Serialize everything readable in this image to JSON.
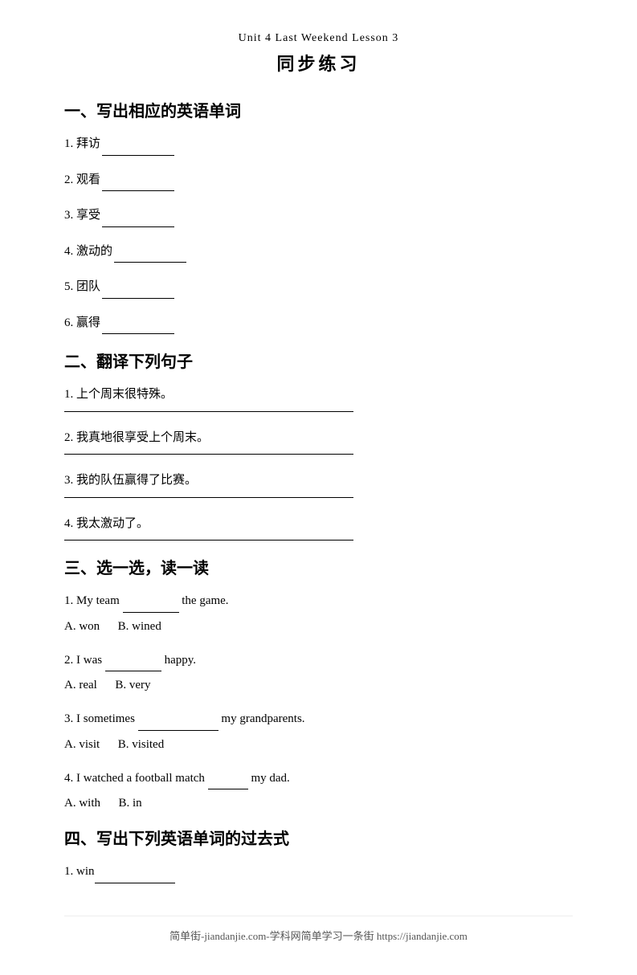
{
  "header": {
    "subtitle": "Unit 4 Last Weekend Lesson 3",
    "title": "同步练习"
  },
  "section1": {
    "title": "一、写出相应的英语单词",
    "items": [
      {
        "num": "1.",
        "text": "拜访"
      },
      {
        "num": "2.",
        "text": "观看"
      },
      {
        "num": "3.",
        "text": "享受"
      },
      {
        "num": "4.",
        "text": "激动的"
      },
      {
        "num": "5.",
        "text": "团队"
      },
      {
        "num": "6.",
        "text": "赢得"
      }
    ]
  },
  "section2": {
    "title": "二、翻译下列句子",
    "items": [
      {
        "num": "1.",
        "text": "上个周末很特殊。"
      },
      {
        "num": "2.",
        "text": "我真地很享受上个周末。"
      },
      {
        "num": "3.",
        "text": "我的队伍赢得了比赛。"
      },
      {
        "num": "4.",
        "text": "我太激动了。"
      }
    ]
  },
  "section3": {
    "title": "三、选一选，读一读",
    "questions": [
      {
        "num": "1.",
        "before": "My team",
        "after": "the game.",
        "optionA": "A. won",
        "optionB": "B. wined"
      },
      {
        "num": "2.",
        "before": "I was",
        "after": "happy.",
        "optionA": "A. real",
        "optionB": "B. very"
      },
      {
        "num": "3.",
        "before": "I sometimes",
        "after": "my grandparents.",
        "optionA": "A. visit",
        "optionB": "B. visited"
      },
      {
        "num": "4.",
        "before": "I watched a football match",
        "after": "my dad.",
        "optionA": "A. with",
        "optionB": "B. in"
      }
    ]
  },
  "section4": {
    "title": "四、写出下列英语单词的过去式",
    "items": [
      {
        "num": "1.",
        "text": "win"
      }
    ]
  },
  "footer": {
    "text": "简单街-jiandanjie.com-学科网简单学习一条街 https://jiandanjie.com"
  }
}
